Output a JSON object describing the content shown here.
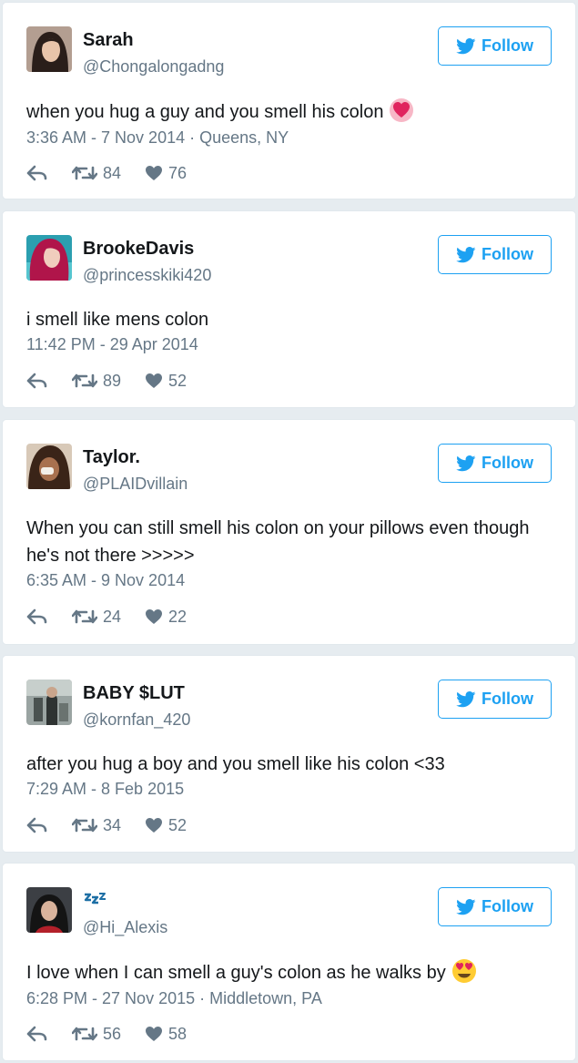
{
  "follow_label": "Follow",
  "brand_color": "#1da1f2",
  "tweets": [
    {
      "name": "Sarah",
      "handle": "@Chongalongadng",
      "text": "when you hug a guy and you smell his colon",
      "emoji": "heart",
      "meta": "3:36 AM - 7 Nov 2014 · Queens, NY",
      "retweets": "84",
      "likes": "76"
    },
    {
      "name": "BrookeDavis",
      "handle": "@princesskiki420",
      "text": "i smell like mens colon",
      "emoji": "",
      "meta": "11:42 PM - 29 Apr 2014",
      "retweets": "89",
      "likes": "52"
    },
    {
      "name": "Taylor.",
      "handle": "@PLAIDvillain",
      "text": "When you can still smell his colon on your pillows even though he's not there >>>>>",
      "emoji": "",
      "meta": "6:35 AM - 9 Nov 2014",
      "retweets": "24",
      "likes": "22"
    },
    {
      "name": "BABY $LUT",
      "handle": "@kornfan_420",
      "text": "after you hug a boy and you smell like his colon <33",
      "emoji": "",
      "meta": "7:29 AM - 8 Feb 2015",
      "retweets": "34",
      "likes": "52"
    },
    {
      "name": "",
      "name_icon": "zzz-icon",
      "handle": "@Hi_Alexis",
      "text": "I love when I can smell a guy's colon as he walks by",
      "emoji": "heart-eyes",
      "meta": "6:28 PM - 27 Nov 2015 · Middletown, PA",
      "retweets": "56",
      "likes": "58"
    }
  ]
}
